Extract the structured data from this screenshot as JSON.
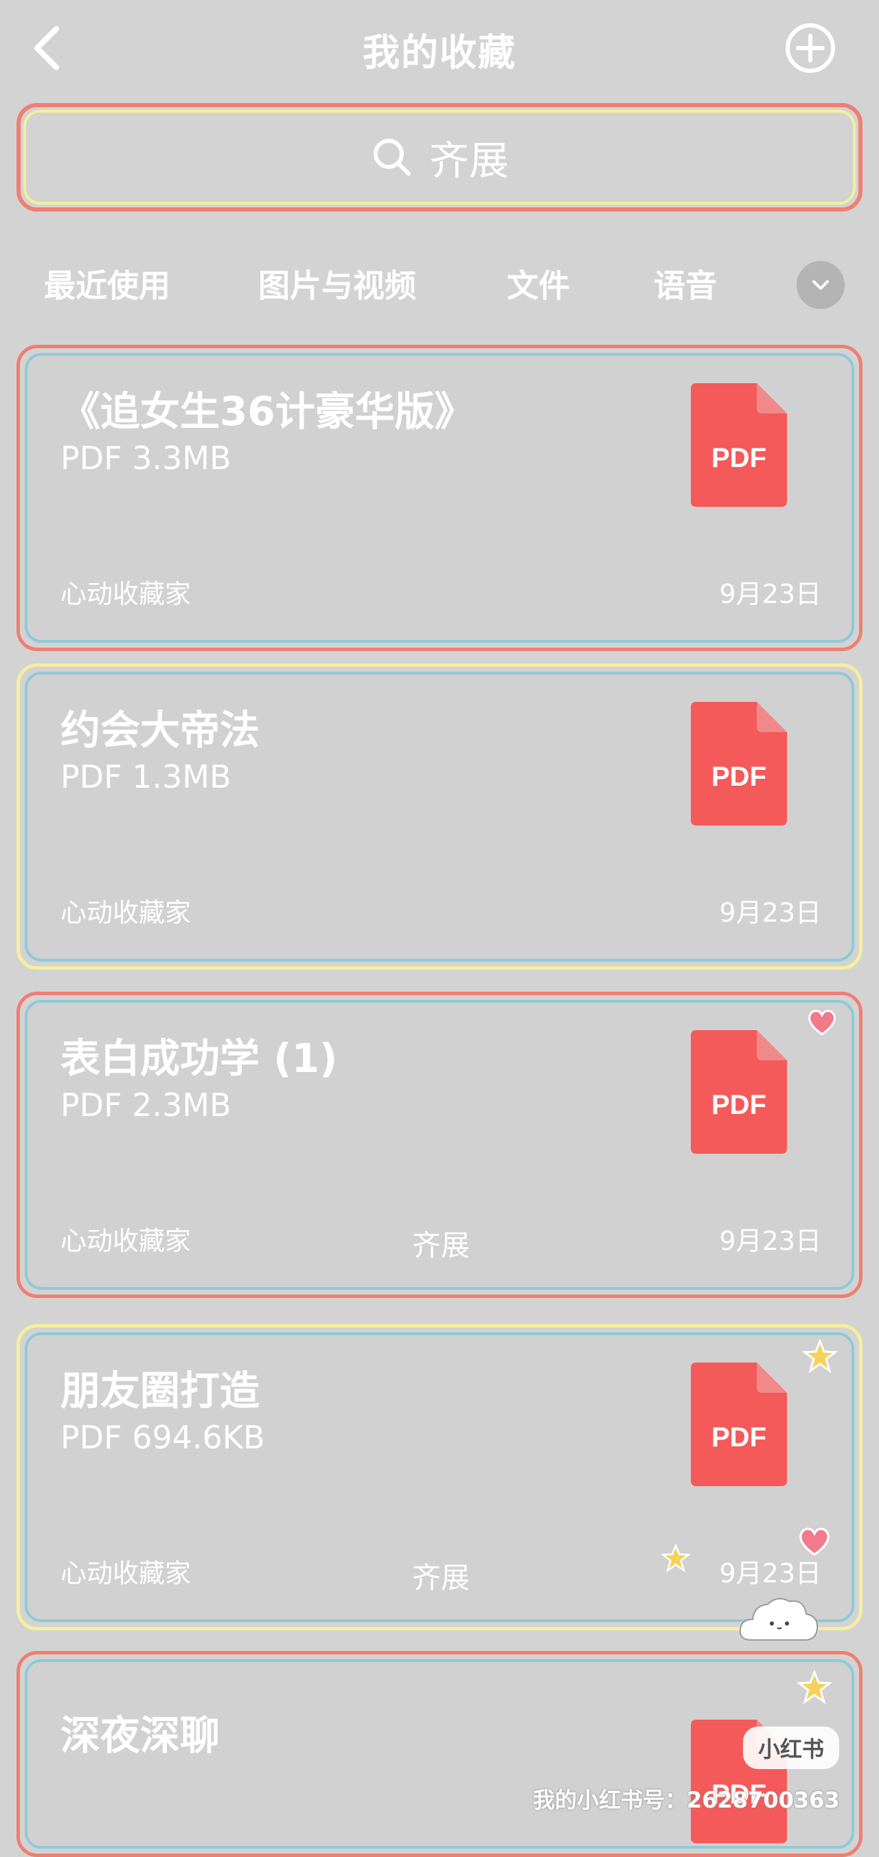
{
  "header": {
    "title": "我的收藏",
    "back_icon": "chevron-left-icon",
    "add_icon": "plus-circle-icon"
  },
  "search": {
    "value": "齐展",
    "icon": "search-icon"
  },
  "tabs": [
    {
      "label": "最近使用"
    },
    {
      "label": "图片与视频"
    },
    {
      "label": "文件"
    },
    {
      "label": "语音"
    }
  ],
  "tabs_expand_icon": "chevron-down-icon",
  "cards": [
    {
      "title": "《追女生36计豪华版》",
      "meta": "PDF 3.3MB",
      "source": "心动收藏家",
      "date": "9月23日",
      "mid": "",
      "badge": "PDF"
    },
    {
      "title": "约会大帝法",
      "meta": "PDF 1.3MB",
      "source": "心动收藏家",
      "date": "9月23日",
      "mid": "",
      "badge": "PDF"
    },
    {
      "title": "表白成功学 (1)",
      "meta": "PDF 2.3MB",
      "source": "心动收藏家",
      "date": "9月23日",
      "mid": "齐展",
      "badge": "PDF"
    },
    {
      "title": "朋友圈打造",
      "meta": "PDF 694.6KB",
      "source": "心动收藏家",
      "date": "9月23日",
      "mid": "齐展",
      "badge": "PDF"
    },
    {
      "title": "深夜深聊",
      "meta": "",
      "source": "",
      "date": "",
      "mid": "",
      "badge": "PDF"
    }
  ],
  "watermark": {
    "logo": "小红书",
    "text": "我的小红书号：2628700363"
  },
  "colors": {
    "background": "#d3d3d3",
    "accent": "#ef7f72",
    "pdf": "#f45a5a",
    "card_border_colors": [
      "#ef7f72",
      "#f4ef9c",
      "#ef7f72",
      "#f4ef9c",
      "#ef7f72"
    ],
    "card_inner_colors": [
      "#8ecad6",
      "#8ecad6",
      "#8ecad6",
      "#8ecad6",
      "#8ecad6"
    ]
  }
}
